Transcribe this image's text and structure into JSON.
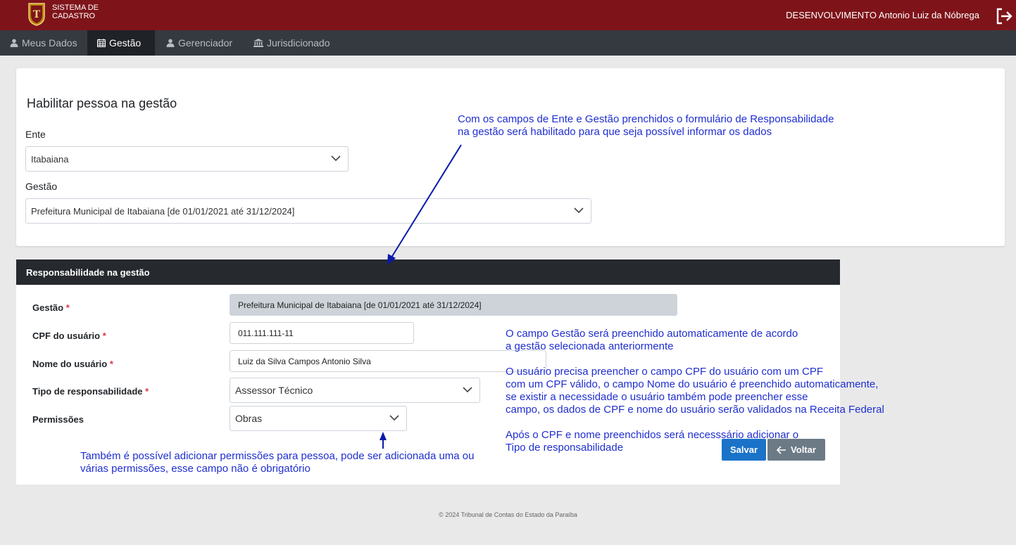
{
  "header": {
    "logo_line1": "SISTEMA DE",
    "logo_line2": "CADASTRO",
    "user": "DESENVOLVIMENTO Antonio Luiz da Nóbrega",
    "logout_icon": "logout-icon"
  },
  "nav": {
    "items": [
      {
        "label": "Meus Dados",
        "icon": "user-icon"
      },
      {
        "label": "Gestão",
        "icon": "calendar-icon",
        "active": true
      },
      {
        "label": "Gerenciador",
        "icon": "user-icon"
      },
      {
        "label": "Jurisdicionado",
        "icon": "institution-icon"
      }
    ]
  },
  "form": {
    "title": "Habilitar pessoa na gestão",
    "ente_label": "Ente",
    "ente_value": "Itabaiana",
    "gestao_label": "Gestão",
    "gestao_value": "Prefeitura Municipal de Itabaiana [de 01/01/2021 até 31/12/2024]"
  },
  "responsabilidade": {
    "header": "Responsabilidade na gestão",
    "gestao_label": "Gestão",
    "gestao_value": "Prefeitura Municipal de Itabaiana [de 01/01/2021 até 31/12/2024]",
    "cpf_label": "CPF do usuário",
    "cpf_value": "011.111.111-11",
    "nome_label": "Nome do usuário",
    "nome_value": "Luiz da Silva Campos Antonio Silva",
    "tipo_label": "Tipo de responsabilidade",
    "tipo_value": "Assessor Técnico",
    "permissoes_label": "Permissões",
    "permissoes_value": "Obras",
    "required_mark": "*",
    "save_label": "Salvar",
    "back_label": "Voltar"
  },
  "annotations": {
    "note1_line1": "Com os campos de Ente e Gestão prenchidos o formulário de Responsabilidade",
    "note1_line2": "na gestão será habilitado para que seja possível informar os dados",
    "note2_line1": "O campo Gestão será preenchido automaticamente de acordo",
    "note2_line2": "a gestão selecionada anteriormente",
    "note3_line1": "O usuário precisa preencher o campo CPF do usuário com um CPF",
    "note3_line2": "com um CPF válido, o campo Nome do usuário é preenchido automaticamente,",
    "note3_line3": "se existir a necessidade o usuário também pode preencher esse",
    "note3_line4": "campo, os dados de CPF e nome do usuário serão validados na Receita Federal",
    "note4_line1": "Após o CPF e nome preenchidos será necesssário adicionar o",
    "note4_line2": "Tipo de responsabilidade",
    "note5_line1": "Também é possível adicionar permissões para pessoa, pode ser adicionada uma ou",
    "note5_line2": "várias permissões, esse campo não é obrigatório"
  },
  "footer": "© 2024 Tribunal de Contas do Estado da Paraíba",
  "colors": {
    "topbar": "#7e141a",
    "navbar": "#343a40",
    "annotation": "#1f2ed0",
    "save": "#1a73c8",
    "back": "#6c7a86"
  }
}
